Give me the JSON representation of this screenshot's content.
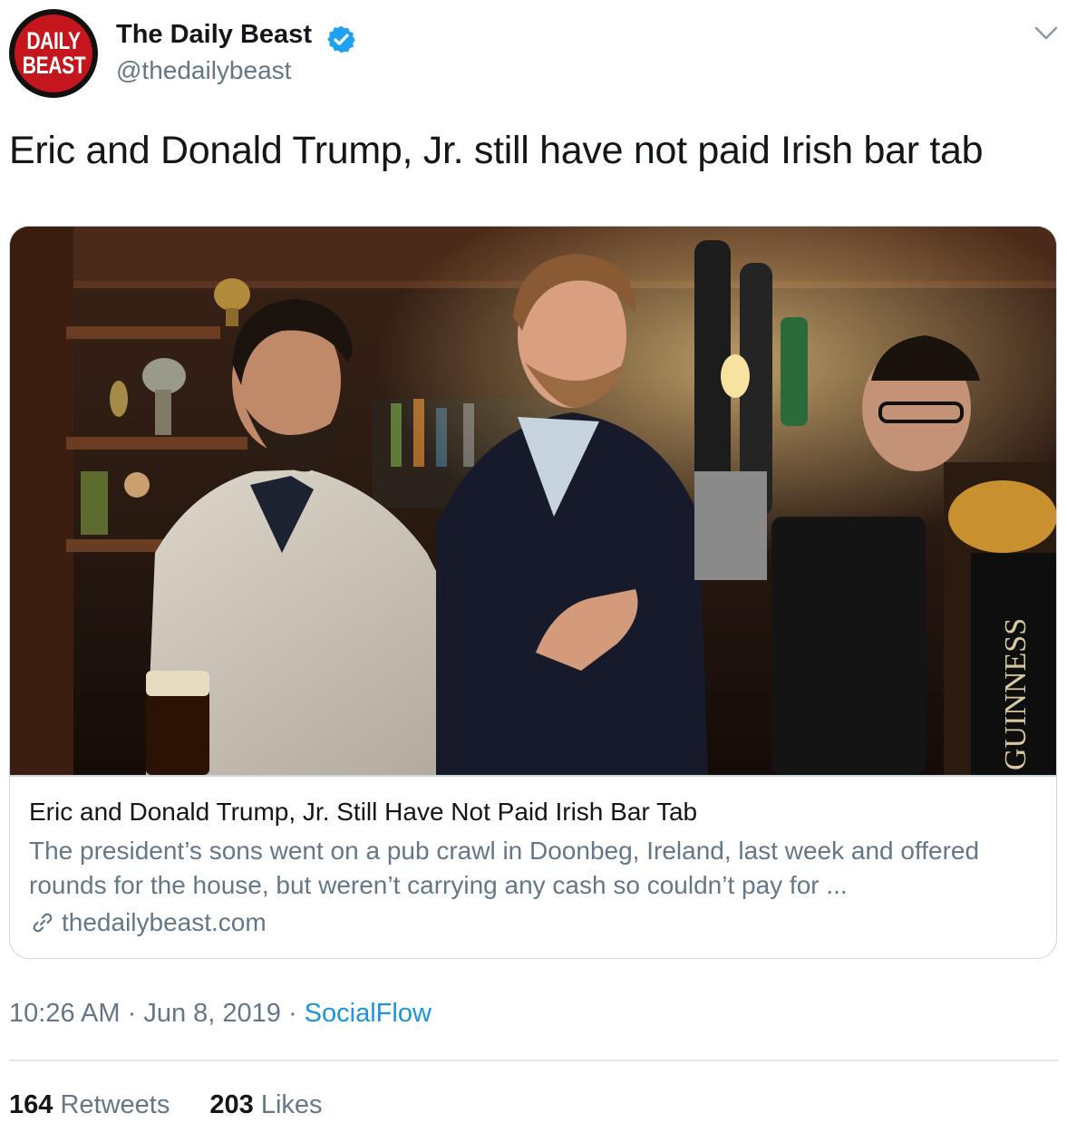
{
  "account": {
    "avatar_line1": "DAILY",
    "avatar_line2": "BEAST",
    "display_name": "The Daily Beast",
    "handle": "@thedailybeast",
    "verified_icon": "verified-badge-icon",
    "menu_icon": "chevron-down-icon"
  },
  "tweet": {
    "text": "Eric and Donald Trump, Jr. still have not paid Irish bar tab"
  },
  "card": {
    "image_icon": "pub-photo",
    "title": "Eric and Donald Trump, Jr. Still Have Not Paid Irish Bar Tab",
    "description": "The president’s sons went on a pub crawl in Doonbeg, Ireland, last week and offered rounds for the house, but weren’t carrying any cash so couldn’t pay for ...",
    "domain": "thedailybeast.com",
    "link_icon": "link-icon",
    "tap_label": "GUINNESS"
  },
  "meta": {
    "time": "10:26 AM",
    "dot1": " · ",
    "date": "Jun 8, 2019",
    "dot2": " · ",
    "source": "SocialFlow"
  },
  "stats": {
    "retweets_count": "164",
    "retweets_label": " Retweets",
    "likes_count": "203",
    "likes_label": " Likes"
  },
  "colors": {
    "text_primary": "#14171a",
    "text_secondary": "#657786",
    "link_blue": "#1b95e0",
    "verified_blue": "#1da1f2",
    "border": "#ccd6dd",
    "avatar_red": "#c5161d"
  }
}
